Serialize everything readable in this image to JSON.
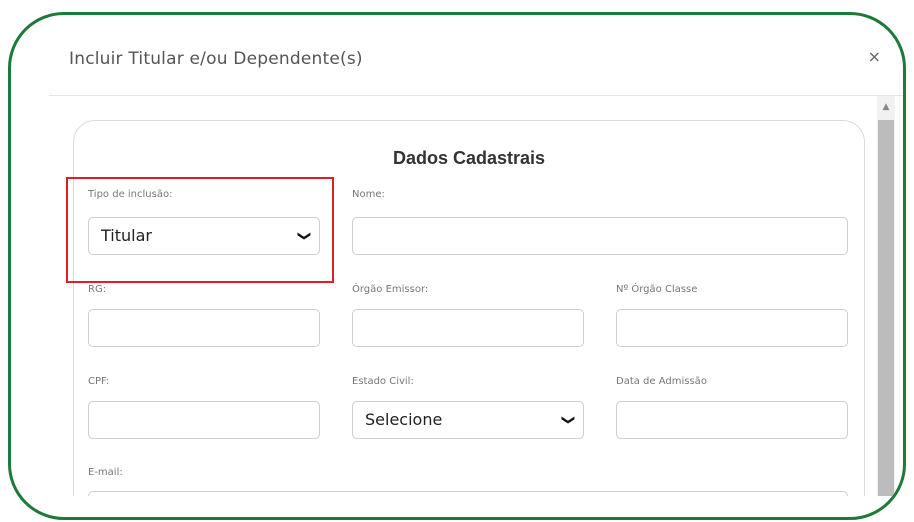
{
  "modal": {
    "title": "Incluir Titular e/ou Dependente(s)",
    "close_glyph": "×"
  },
  "form": {
    "section_title": "Dados Cadastrais",
    "tipo_inclusao": {
      "label": "Tipo de inclusão:",
      "value": "Titular"
    },
    "nome": {
      "label": "Nome:",
      "value": ""
    },
    "rg": {
      "label": "RG:",
      "value": ""
    },
    "orgao_emissor": {
      "label": "Órgão Emissor:",
      "value": ""
    },
    "orgao_classe": {
      "label": "Nº Órgão Classe",
      "value": ""
    },
    "cpf": {
      "label": "CPF:",
      "value": ""
    },
    "estado_civil": {
      "label": "Estado Civil:",
      "value": "Selecione"
    },
    "data_admissao": {
      "label": "Data de Admissão",
      "value": ""
    },
    "email": {
      "label": "E-mail:",
      "value": ""
    }
  },
  "icons": {
    "chevron": "❯",
    "scroll_up": "▲"
  },
  "colors": {
    "frame_border": "#1e7a3a",
    "highlight": "#e02020"
  }
}
